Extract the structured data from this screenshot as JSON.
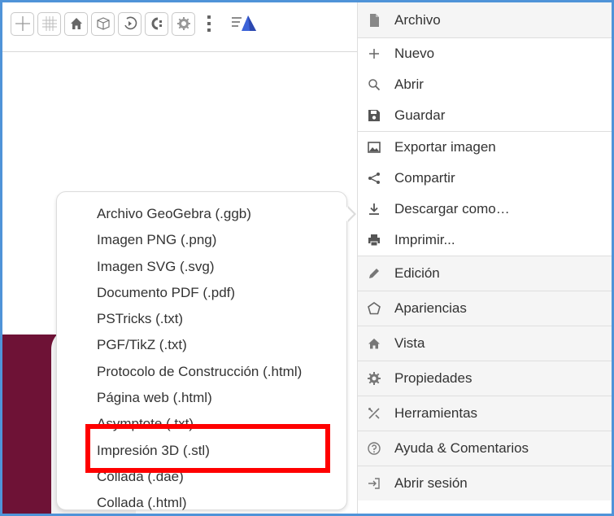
{
  "window": {
    "border_color": "#4f93d8",
    "surface_color": "#6e1236"
  },
  "toolbar": {
    "buttons": [
      {
        "name": "axes-icon"
      },
      {
        "name": "grid-icon"
      },
      {
        "name": "home-icon"
      },
      {
        "name": "cube-icon"
      },
      {
        "name": "rotate-icon"
      },
      {
        "name": "projection-icon"
      },
      {
        "name": "gear-icon"
      }
    ],
    "more_icon": "vertical-dots-icon",
    "menu_toggle_icon": "menu-triangle-icon"
  },
  "download_menu": {
    "items": [
      "Archivo GeoGebra (.ggb)",
      "Imagen PNG (.png)",
      "Imagen SVG (.svg)",
      "Documento PDF (.pdf)",
      "PSTricks (.txt)",
      "PGF/TikZ (.txt)",
      "Protocolo de Construcción (.html)",
      "Página web (.html)",
      "Asymptote (.txt)",
      "Impresión 3D (.stl)",
      "Collada (.dae)",
      "Collada (.html)"
    ],
    "highlighted_item": "Impresión 3D (.stl)",
    "highlight_color": "#ff0000"
  },
  "main_menu": {
    "file_header": "Archivo",
    "file_items": [
      {
        "label": "Nuevo",
        "icon": "plus-icon"
      },
      {
        "label": "Abrir",
        "icon": "search-icon"
      },
      {
        "label": "Guardar",
        "icon": "save-icon"
      },
      {
        "label": "Exportar imagen",
        "icon": "image-icon"
      },
      {
        "label": "Compartir",
        "icon": "share-icon"
      },
      {
        "label": "Descargar como…",
        "icon": "download-icon"
      },
      {
        "label": "Imprimir...",
        "icon": "print-icon"
      }
    ],
    "groups": [
      {
        "label": "Edición",
        "icon": "pencil-icon"
      },
      {
        "label": "Apariencias",
        "icon": "pentagon-icon"
      },
      {
        "label": "Vista",
        "icon": "home-icon"
      },
      {
        "label": "Propiedades",
        "icon": "gear-icon"
      },
      {
        "label": "Herramientas",
        "icon": "tools-icon"
      },
      {
        "label": "Ayuda & Comentarios",
        "icon": "help-icon"
      },
      {
        "label": "Abrir sesión",
        "icon": "sign-in-icon"
      }
    ]
  }
}
